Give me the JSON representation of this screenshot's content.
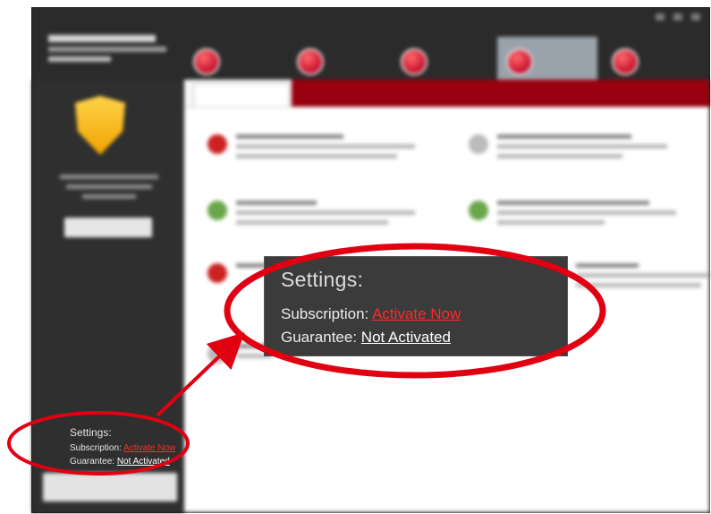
{
  "settings_panel": {
    "title": "Settings:",
    "subscription_label": "Subscription:",
    "subscription_link": "Activate Now",
    "guarantee_label": "Guarantee:",
    "guarantee_link": "Not Activated"
  },
  "callout": {
    "title": "Settings:",
    "subscription_label": "Subscription:",
    "subscription_link": "Activate Now",
    "guarantee_label": "Guarantee:",
    "guarantee_link": "Not Activated"
  },
  "icons": {
    "shield": "shield-icon",
    "nav_badge": "nav-badge-icon"
  },
  "colors": {
    "annotation_red": "#e00012",
    "link_red": "#ff2a2a",
    "shield_yellow": "#f1a400",
    "nav_badge_red": "#c8102e",
    "app_dark": "#2b2b2b",
    "tab_bar_red": "#9a0010"
  }
}
